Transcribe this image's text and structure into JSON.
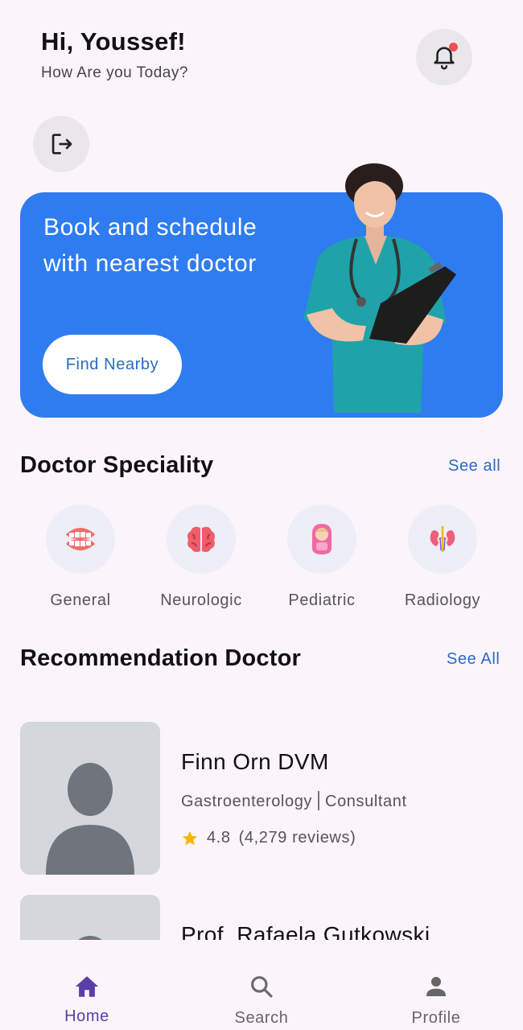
{
  "header": {
    "greeting": "Hi, Youssef!",
    "subtitle": "How Are you Today?",
    "notification_icon": "bell-icon",
    "logout_icon": "logout-icon"
  },
  "banner": {
    "text": "Book and schedule with nearest doctor",
    "button_label": "Find Nearby",
    "image": "nurse-with-clipboard"
  },
  "speciality": {
    "title": "Doctor Speciality",
    "see_all": "See all",
    "items": [
      {
        "label": "General",
        "icon": "teeth-icon"
      },
      {
        "label": "Neurologic",
        "icon": "brain-icon"
      },
      {
        "label": "Pediatric",
        "icon": "baby-icon"
      },
      {
        "label": "Radiology",
        "icon": "kidney-icon"
      }
    ]
  },
  "recommendation": {
    "title": "Recommendation Doctor",
    "see_all": "See All",
    "doctors": [
      {
        "name": "Finn Orn DVM",
        "specialty": "Gastroenterology",
        "role": "Consultant",
        "rating": "4.8",
        "reviews": "(4,279 reviews)"
      },
      {
        "name": "Prof. Rafaela Gutkowski"
      }
    ]
  },
  "nav": {
    "items": [
      {
        "label": "Home",
        "icon": "home-icon",
        "active": true
      },
      {
        "label": "Search",
        "icon": "search-icon",
        "active": false
      },
      {
        "label": "Profile",
        "icon": "person-icon",
        "active": false
      }
    ]
  },
  "colors": {
    "background": "#fcf4fb",
    "primary": "#2f7cf0",
    "link": "#2a6bc2",
    "nav_active": "#5b3fa8",
    "star": "#f2b705"
  }
}
